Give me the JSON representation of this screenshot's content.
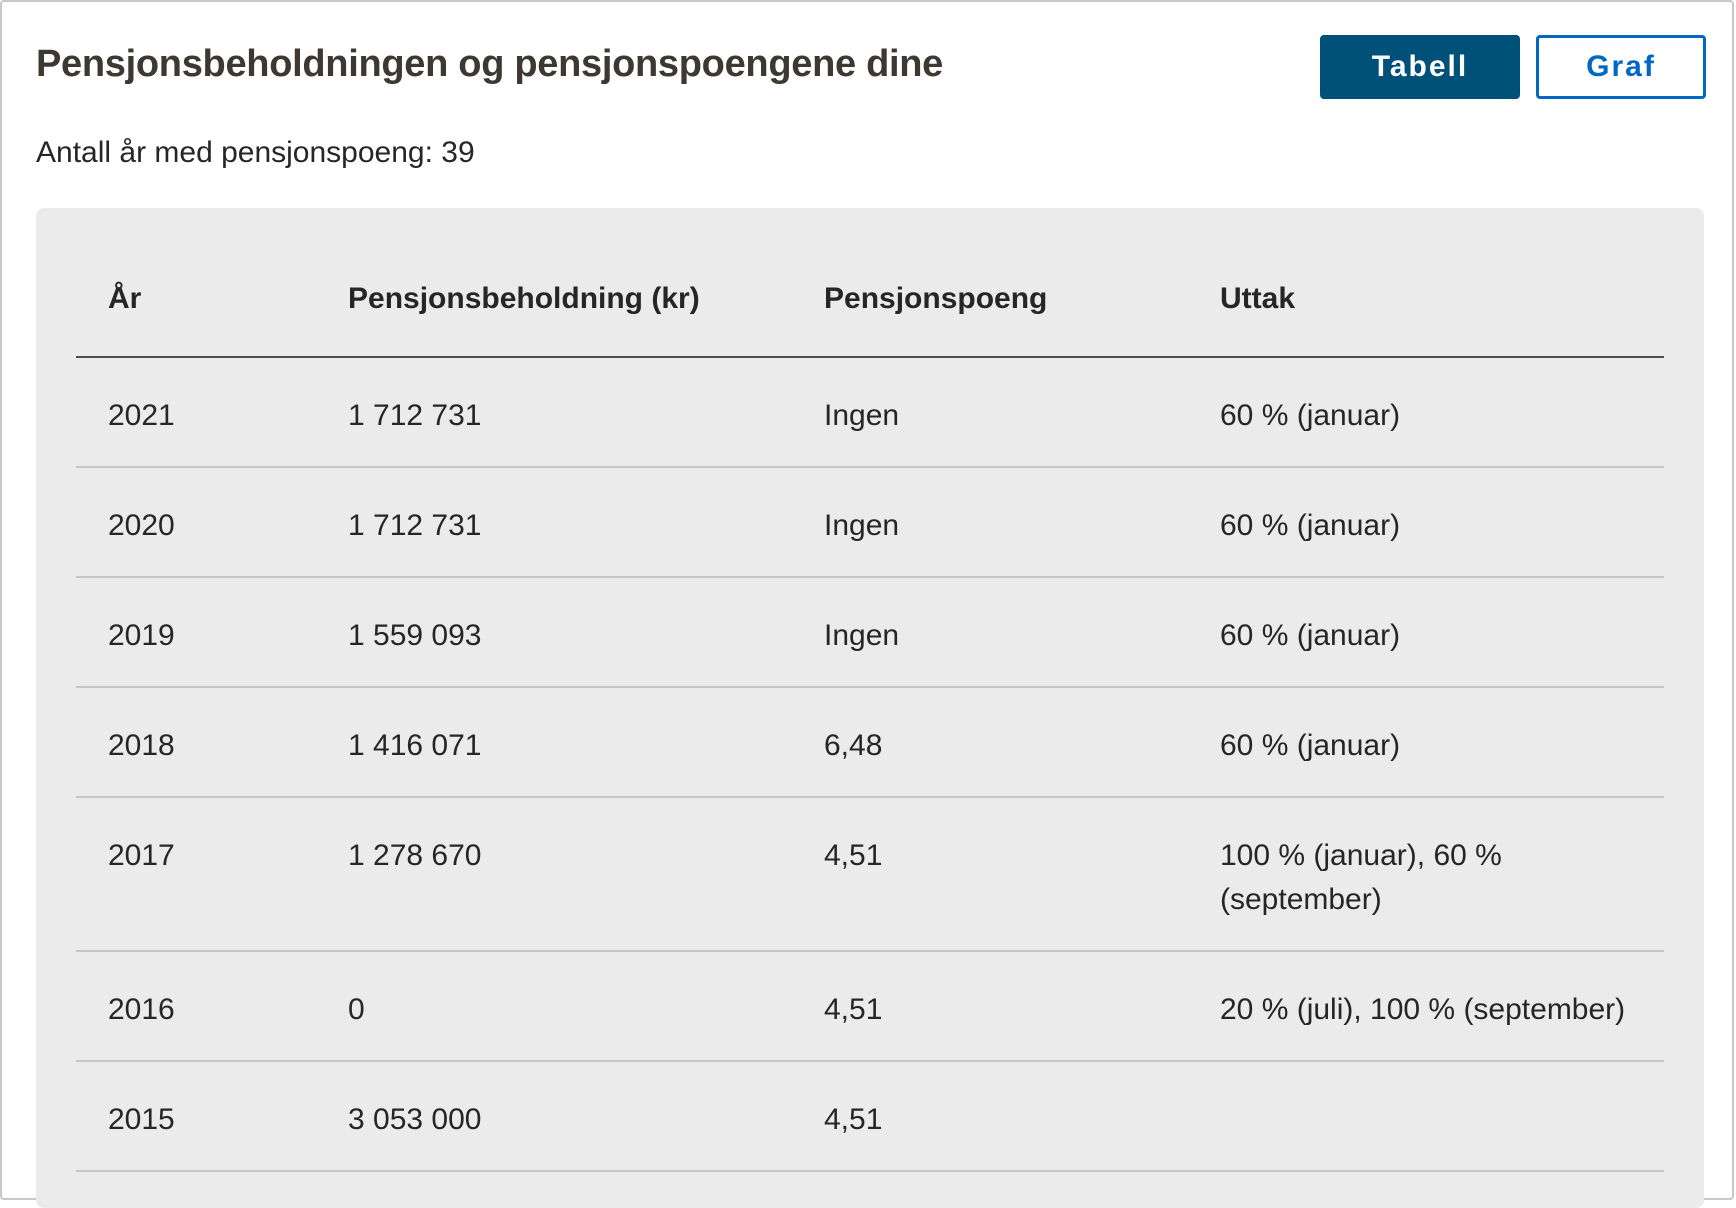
{
  "header": {
    "title": "Pensjonsbeholdningen og pensjonspoengene dine",
    "view_toggle": {
      "table_label": "Tabell",
      "graph_label": "Graf",
      "selected": "Tabell"
    }
  },
  "summary": {
    "text": "Antall år med pensjonspoeng: 39"
  },
  "table": {
    "columns": [
      "År",
      "Pensjonsbeholdning (kr)",
      "Pensjonspoeng",
      "Uttak"
    ],
    "rows": [
      {
        "year": "2021",
        "holding": "1 712 731",
        "points": "Ingen",
        "withdrawal": "60 % (januar)"
      },
      {
        "year": "2020",
        "holding": "1 712 731",
        "points": "Ingen",
        "withdrawal": "60 % (januar)"
      },
      {
        "year": "2019",
        "holding": "1 559 093",
        "points": "Ingen",
        "withdrawal": "60 % (januar)"
      },
      {
        "year": "2018",
        "holding": "1 416 071",
        "points": "6,48",
        "withdrawal": "60 % (januar)"
      },
      {
        "year": "2017",
        "holding": "1 278 670",
        "points": "4,51",
        "withdrawal": "100 % (januar), 60 % (september)"
      },
      {
        "year": "2016",
        "holding": "0",
        "points": "4,51",
        "withdrawal": "20 % (juli), 100 % (september)"
      },
      {
        "year": "2015",
        "holding": "3 053 000",
        "points": "4,51",
        "withdrawal": ""
      }
    ]
  },
  "colors": {
    "primary_button": "#005179",
    "link_blue": "#0067c5",
    "panel_bg": "#ebebeb",
    "title_text": "#3e3832",
    "body_text": "#262626"
  }
}
